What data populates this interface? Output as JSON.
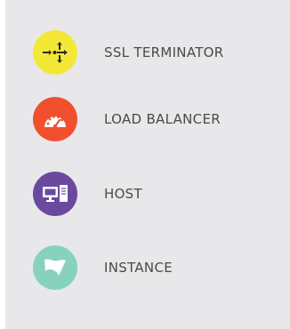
{
  "legend": {
    "items": [
      {
        "label": "SSL TERMINATOR",
        "icon": "split-arrows-icon",
        "color": "#f4e836"
      },
      {
        "label": "LOAD BALANCER",
        "icon": "speedometer-icon",
        "color": "#f0502e"
      },
      {
        "label": "HOST",
        "icon": "computer-server-icon",
        "color": "#6a4a9e"
      },
      {
        "label": "INSTANCE",
        "icon": "flag-icon",
        "color": "#86d2be"
      }
    ]
  }
}
